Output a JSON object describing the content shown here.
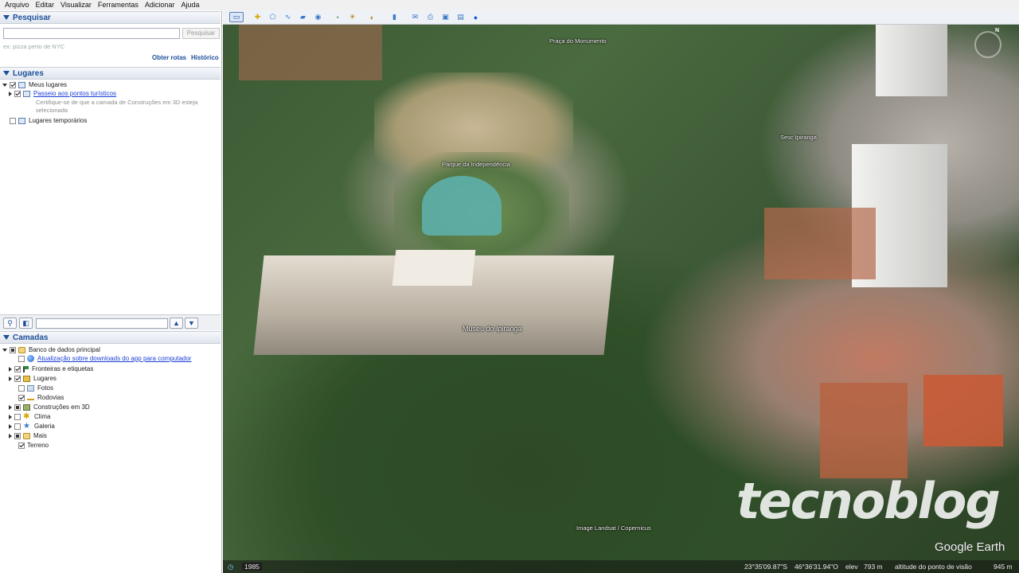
{
  "menu": [
    "Arquivo",
    "Editar",
    "Visualizar",
    "Ferramentas",
    "Adicionar",
    "Ajuda"
  ],
  "search": {
    "title": "Pesquisar",
    "placeholder": "",
    "button": "Pesquisar",
    "hint": "ex: pizza perto de NYC",
    "get_routes": "Obter rotas",
    "history": "Histórico"
  },
  "places": {
    "title": "Lugares",
    "my_places": "Meus lugares",
    "tour": "Passeio aos pontos turísticos",
    "tour_note_1": "Certifique-se de que a camada de Construções em 3D esteja",
    "tour_note_2": "selecionada",
    "temp": "Lugares temporários"
  },
  "layers": {
    "title": "Camadas",
    "main_db": "Banco de dados principal",
    "update": "Atualização sobre downloads do app para computador",
    "items": [
      "Fronteiras e etiquetas",
      "Lugares",
      "Fotos",
      "Rodovias",
      "Construções em 3D",
      "Clima",
      "Galeria",
      "Mais",
      "Terreno"
    ]
  },
  "map": {
    "label_museum": "Museu do Ipiranga",
    "label_park": "Parque da Independência",
    "label_street": "Praça do Monumento",
    "label_area": "Sesc Ipiranga",
    "imagery": "Image Landsat / Copernicus",
    "watermark": "tecnoblog",
    "brand": "Google Earth",
    "compass_n": "N"
  },
  "status": {
    "year": "1985",
    "lat": "23°35'09.87\"S",
    "lon": "46°36'31.94\"O",
    "elev_label": "elev",
    "elev": "793 m",
    "alt_label": "altitude do ponto de visão",
    "alt": "945 m"
  },
  "toolbar_icons": [
    "sidebar-icon",
    "placemark-icon",
    "polygon-icon",
    "path-icon",
    "overlay-icon",
    "tour-icon",
    "historical-icon",
    "sun-icon",
    "planets-icon",
    "ruler-icon",
    "email-icon",
    "print-icon",
    "save-image-icon",
    "maps-icon",
    "earth-icon"
  ]
}
